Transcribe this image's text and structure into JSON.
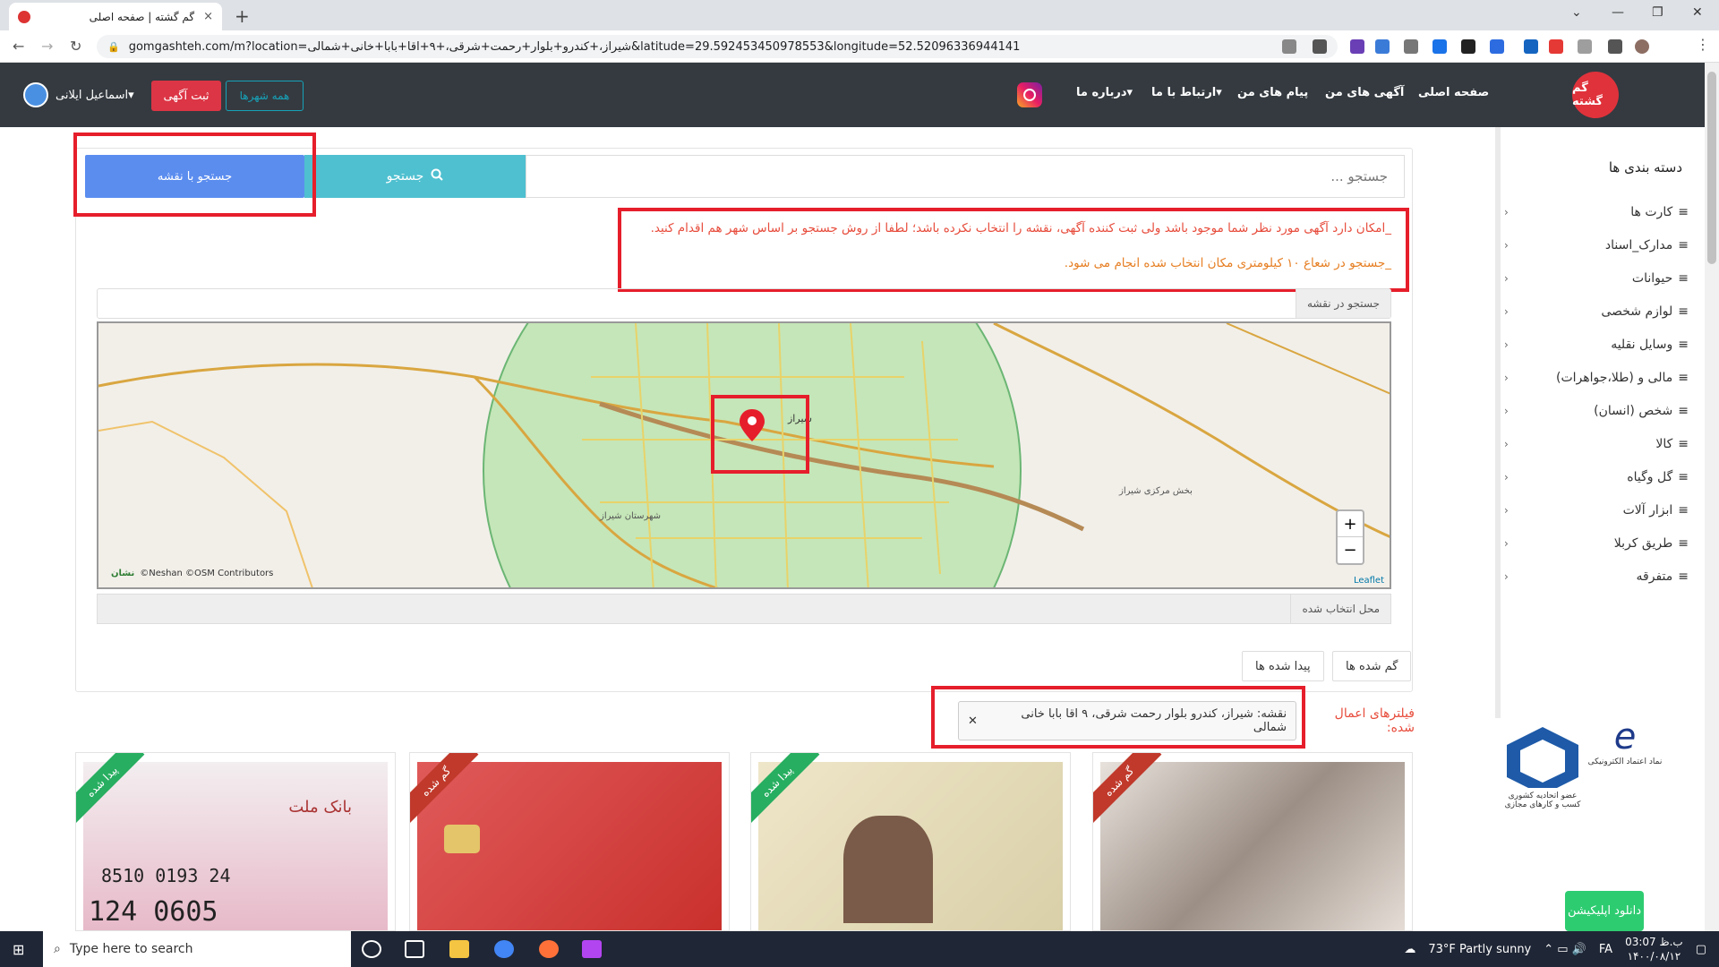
{
  "browser": {
    "tab_title": "گم گشته | صفحه اصلی",
    "tab_close": "×",
    "new_tab": "+",
    "url": "gomgashteh.com/m?location=شیراز،+کندرو+بلوار+رحمت+شرقی،+۹+اقا+بابا+خانی+شمالی&latitude=29.592453450978553&longitude=52.52096336944141"
  },
  "site": {
    "logo_text": "گم گشته",
    "nav": [
      "صفحه اصلی",
      "آگهی های من",
      "پیام های من",
      "ارتباط با ما▾",
      "درباره ما▾"
    ],
    "post_button": "ثبت آگهی",
    "cities_button": "همه شهرها",
    "user_name": "اسماعیل ایلانی▾"
  },
  "search": {
    "placeholder": "جستجو ...",
    "search_button": "جستجو",
    "map_button": "جستجو با نقشه"
  },
  "notes": {
    "line1": "_امکان دارد آگهی مورد نظر شما موجود باشد ولی ثبت کننده آگهی، نقشه را انتخاب نکرده باشد؛ لطفا از روش جستجو بر اساس شهر هم اقدام کنید.",
    "line2": "_جستجو در شعاع ۱۰ کیلومتری مکان انتخاب شده انجام می شود."
  },
  "map": {
    "search_label": "جستجو در نقشه",
    "attribution": "©Neshan ©OSM Contributors",
    "neshan": "نشان",
    "leaflet": "Leaflet",
    "zoom_in": "+",
    "zoom_out": "−",
    "city_label": "شیراز",
    "label_east": "بخش مرکزی شیراز",
    "label_sw": "شهرستان شیراز",
    "selected_label": "محل انتخاب شده"
  },
  "toggles": {
    "lost": "گم شده ها",
    "found": "پیدا شده ها"
  },
  "filters": {
    "label": "فیلترهای اعمال شده:",
    "chip": "نقشه: شیراز، کندرو بلوار رحمت شرقی، ۹ اقا بابا خانی شمالی"
  },
  "listings": [
    {
      "ribbon": "گم شده",
      "color": "#c0392b",
      "desc": "dog"
    },
    {
      "ribbon": "پیدا شده",
      "color": "#27ae60",
      "desc": "id-card"
    },
    {
      "ribbon": "گم شده",
      "color": "#c0392b",
      "desc": "fuel-card"
    },
    {
      "ribbon": "پیدا شده",
      "color": "#27ae60",
      "desc": "bank-card"
    }
  ],
  "listing_texts": {
    "card_top": "بانک ملت",
    "card_num1": "8510 0193 24",
    "card_num2": "124   0605"
  },
  "sidebar": {
    "title": "دسته بندی ها",
    "categories": [
      "کارت ها",
      "مدارک_اسناد",
      "حیوانات",
      "لوازم شخصی",
      "وسایل نقلیه",
      "مالی و (طلا،جواهرات)",
      "شخص (انسان)",
      "کالا",
      "گل وگیاه",
      "ابزار آلات",
      "طریق کربلا",
      "متفرقه"
    ],
    "download": "دانلود اپلیکیشن",
    "badge1": "عضو اتحادیه کشوری کسب و کارهای مجازی",
    "badge2": "نماد اعتماد الکترونیکی"
  },
  "taskbar": {
    "search_placeholder": "Type here to search",
    "weather": "73°F  Partly sunny",
    "lang": "FA",
    "time": "ب.ظ 03:07",
    "date": "۱۴۰۰/۰۸/۱۲"
  }
}
